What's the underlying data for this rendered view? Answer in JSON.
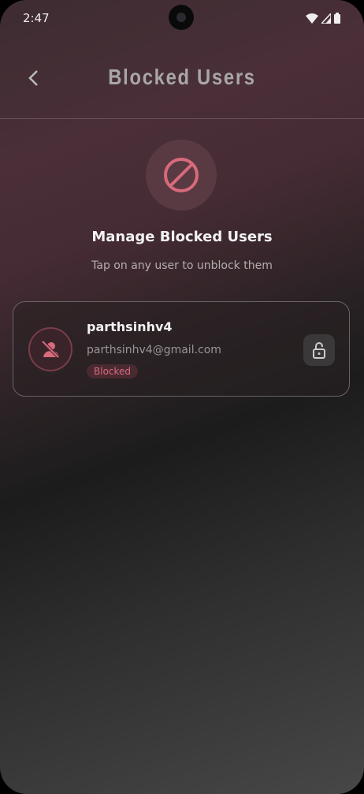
{
  "status_bar": {
    "time": "2:47",
    "icons": [
      "wifi-icon",
      "signal-icon",
      "battery-icon"
    ]
  },
  "header": {
    "title": "Blocked Users",
    "back_icon": "chevron-left-icon"
  },
  "intro": {
    "icon": "block-icon",
    "heading": "Manage Blocked Users",
    "subtitle": "Tap on any user to unblock them"
  },
  "blocked_users": [
    {
      "username": "parthsinhv4",
      "email": "parthsinhv4@gmail.com",
      "status": "Blocked",
      "avatar_icon": "person-off-icon",
      "action_icon": "unlock-icon"
    }
  ],
  "colors": {
    "accent": "#d86a7c"
  }
}
